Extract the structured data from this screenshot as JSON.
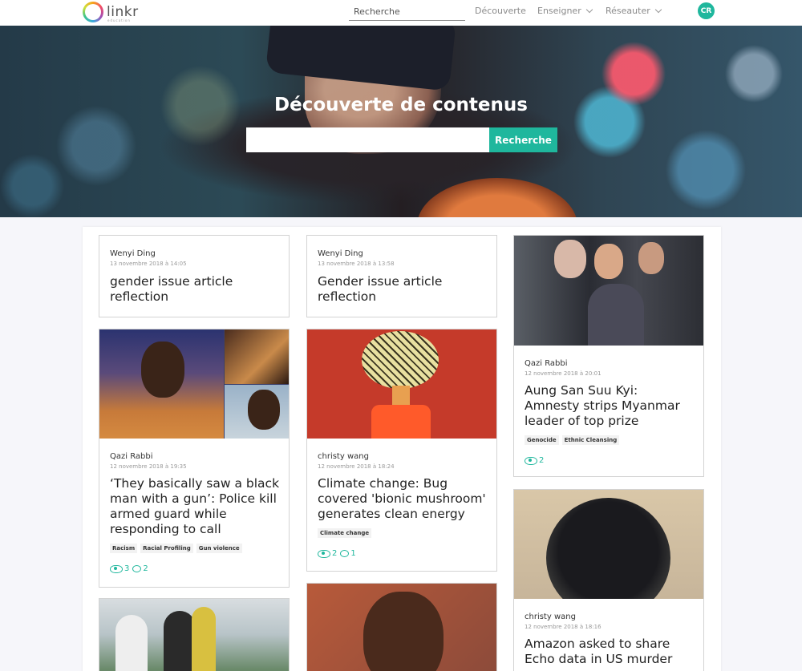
{
  "header": {
    "logo_text": "linkr",
    "logo_sub": "education",
    "search_placeholder": "Recherche",
    "nav": [
      "Découverte",
      "Enseigner",
      "Réseauter"
    ],
    "avatar_initials": "CR"
  },
  "hero": {
    "title": "Découverte de contenus",
    "search_button": "Recherche"
  },
  "cards": [
    {
      "author": "Wenyi Ding",
      "date": "13 novembre 2018 à 14:05",
      "title": "gender issue article reflection"
    },
    {
      "author": "Wenyi Ding",
      "date": "13 novembre 2018 à 13:58",
      "title": "Gender issue article reflection"
    },
    {
      "author": "Qazi Rabbi",
      "date": "12 novembre 2018 à 20:01",
      "title": "Aung San Suu Kyi: Amnesty strips Myanmar leader of top prize",
      "tags": [
        "Genocide",
        "Ethnic Cleansing"
      ],
      "views": "2"
    },
    {
      "author": "Qazi Rabbi",
      "date": "12 novembre 2018 à 19:35",
      "title": "‘They basically saw a black man with a gun’: Police kill armed guard while responding to call",
      "tags": [
        "Racism",
        "Racial Profiling",
        "Gun violence"
      ],
      "views": "3",
      "comments": "2"
    },
    {
      "author": "christy wang",
      "date": "12 novembre 2018 à 18:24",
      "title": "Climate change: Bug covered 'bionic mushroom' generates clean energy",
      "tags": [
        "Climate change"
      ],
      "views": "2",
      "comments": "1"
    },
    {
      "author": "christy wang",
      "date": "12 novembre 2018 à 18:16",
      "title": "Amazon asked to share Echo data in US murder"
    }
  ],
  "colors": {
    "accent": "#1fb79d"
  }
}
